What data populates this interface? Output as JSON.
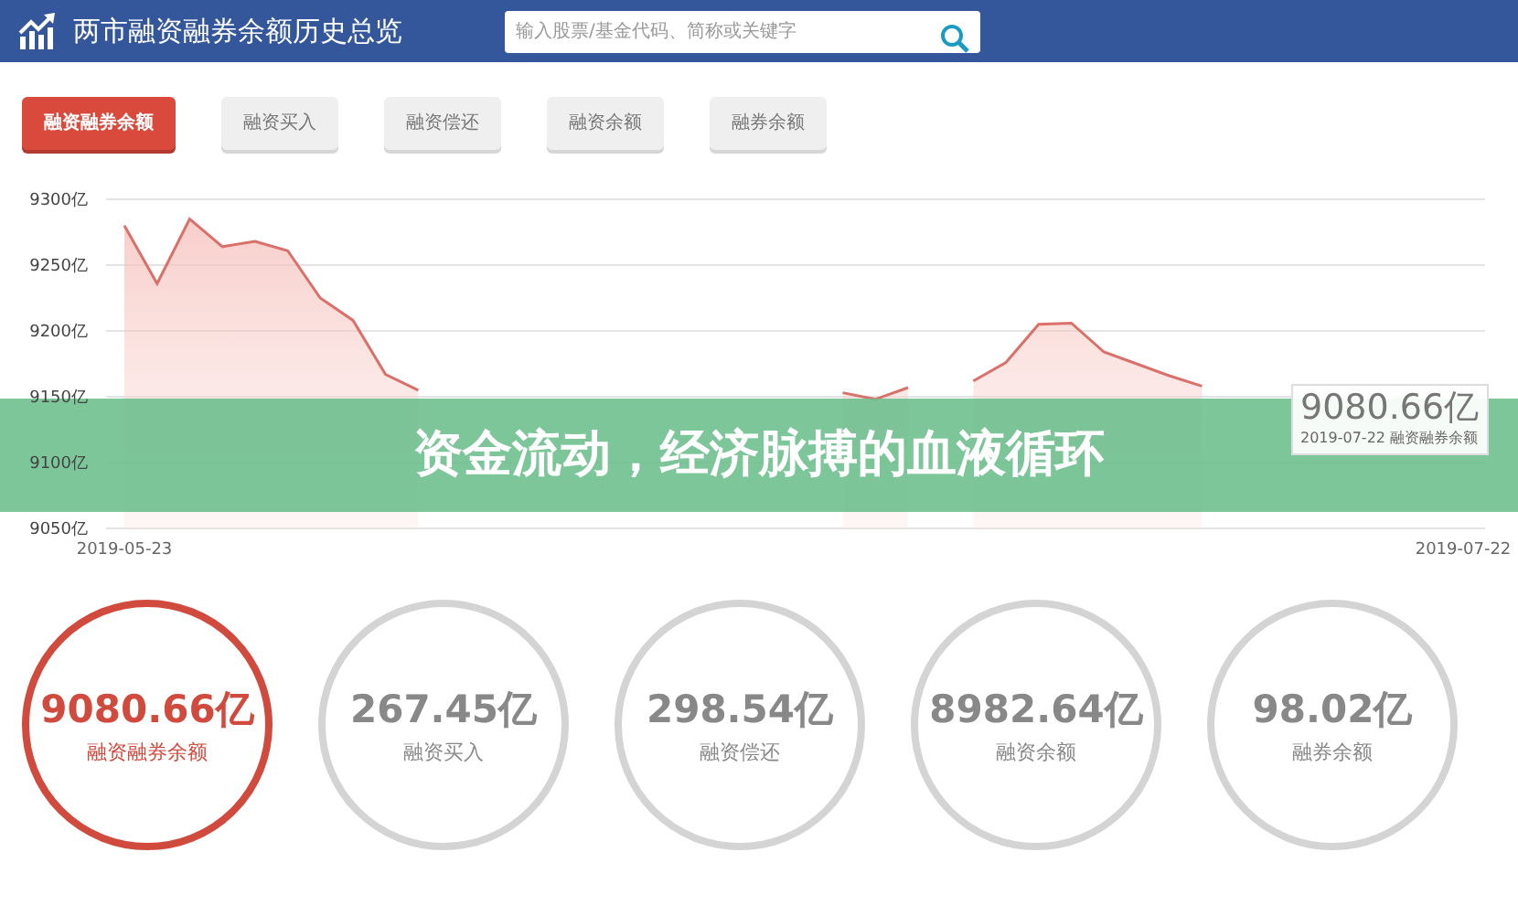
{
  "header": {
    "title": "两市融资融券余额历史总览",
    "search": {
      "placeholder": "输入股票/基金代码、简称或关键字"
    }
  },
  "tabs": [
    {
      "label": "融资融券余额",
      "selected": true
    },
    {
      "label": "融资买入",
      "selected": false
    },
    {
      "label": "融资偿还",
      "selected": false
    },
    {
      "label": "融资余额",
      "selected": false
    },
    {
      "label": "融券余额",
      "selected": false
    }
  ],
  "chart": {
    "tooltip": {
      "value": "9080.66亿",
      "date": "2019-07-22",
      "series": "融资融券余额"
    },
    "chart_data": {
      "type": "area",
      "categories": [
        "2019-05-23",
        null,
        null,
        null,
        null,
        null,
        null,
        null,
        null,
        null,
        null,
        null,
        null,
        null,
        null,
        null,
        null,
        null,
        null,
        null,
        null,
        null,
        null,
        null,
        null,
        null,
        null,
        null,
        null,
        null,
        null,
        null,
        null,
        null,
        null,
        null,
        null,
        null,
        null,
        null,
        null,
        "2019-07-22"
      ],
      "series": [
        {
          "color": "#d9706a",
          "values": [
            9280,
            9236,
            9285,
            9264,
            9268,
            9261,
            9225,
            9208,
            9167,
            9155,
            null,
            null,
            null,
            null,
            null,
            null,
            null,
            null,
            null,
            null,
            null,
            null,
            9153,
            9148,
            9157,
            null,
            9162,
            9176,
            9205,
            9206,
            9184,
            9175,
            9166,
            9158,
            null,
            null,
            null,
            null,
            null,
            null,
            null,
            null
          ]
        }
      ],
      "grid": true,
      "ylim": [
        9050,
        9300
      ],
      "yticks": [
        {
          "value": 9050,
          "label": "9050亿"
        },
        {
          "value": 9100,
          "label": "9100亿"
        },
        {
          "value": 9150,
          "label": "9150亿"
        },
        {
          "value": 9200,
          "label": "9200亿"
        },
        {
          "value": 9250,
          "label": "9250亿"
        },
        {
          "value": 9300,
          "label": "9300亿"
        }
      ]
    }
  },
  "banner": {
    "text": "资金流动，经济脉搏的血液循环"
  },
  "stats": [
    {
      "value": "9080.66亿",
      "label": "融资融券余额",
      "selected": true
    },
    {
      "value": "267.45亿",
      "label": "融资买入",
      "selected": false
    },
    {
      "value": "298.54亿",
      "label": "融资偿还",
      "selected": false
    },
    {
      "value": "8982.64亿",
      "label": "融资余额",
      "selected": false
    },
    {
      "value": "98.02亿",
      "label": "融券余额",
      "selected": false
    }
  ]
}
